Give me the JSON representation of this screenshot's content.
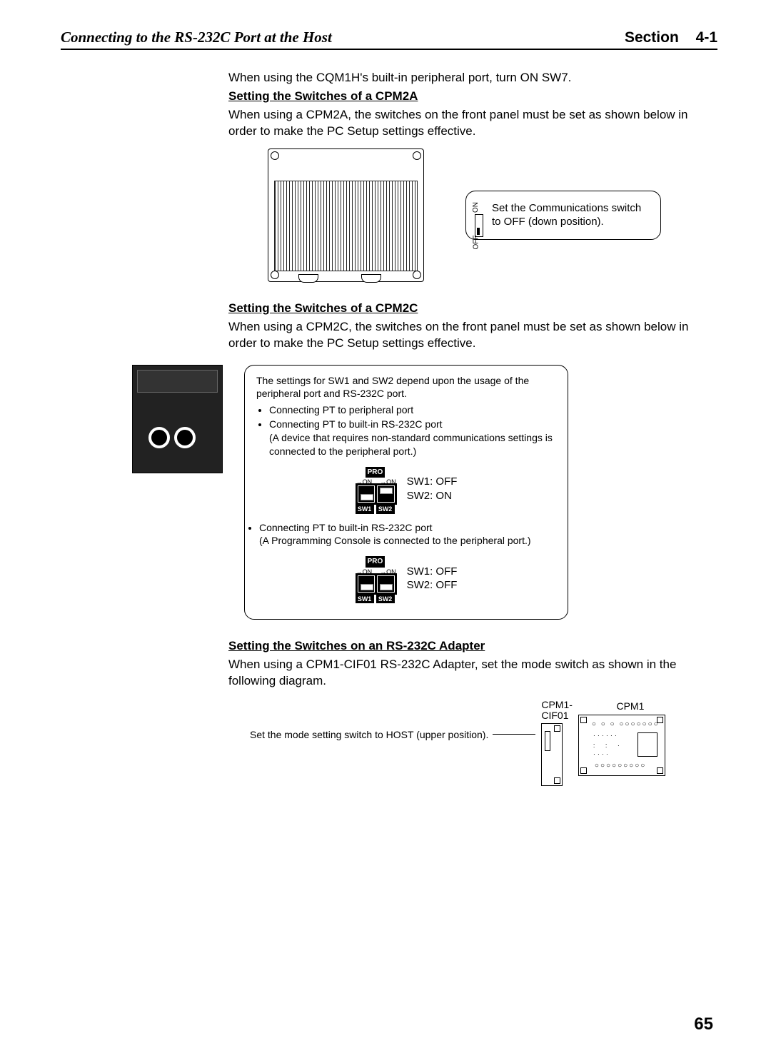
{
  "header": {
    "title": "Connecting to the RS-232C Port at the Host",
    "section_label": "Section",
    "section_num": "4-1"
  },
  "intro_line": "When using the CQM1H's built-in peripheral port, turn ON SW7.",
  "cpm2a": {
    "heading": "Setting the Switches of a CPM2A",
    "body": "When using a CPM2A, the switches on the front panel must be set as shown below in order to make the PC Setup settings effective.",
    "callout": "Set the Communications switch to OFF (down position).",
    "on_label": "ON",
    "off_label": "OFF"
  },
  "cpm2c": {
    "heading": "Setting the Switches of a CPM2C",
    "body": "When using a CPM2C, the switches on the front panel must be set as shown below in order to make the PC Setup settings effective.",
    "box_intro": "The settings for SW1 and SW2 depend upon the usage of the peripheral port and RS-232C port.",
    "bullet1": "Connecting PT to peripheral port",
    "bullet2": "Connecting PT to built-in RS-232C port",
    "bullet2_note": "(A device that requires non-standard communications settings is connected to the peripheral port.)",
    "state1_sw1": "SW1: OFF",
    "state1_sw2": "SW2: ON",
    "bullet3": "Connecting PT to built-in RS-232C port",
    "bullet3_note": "(A Programming Console is connected to the peripheral port.)",
    "state2_sw1": "SW1: OFF",
    "state2_sw2": "SW2: OFF",
    "pro": "PRO",
    "sw1": "SW1",
    "sw2": "SW2",
    "arrow_on": "→ON"
  },
  "adapter": {
    "heading": "Setting the Switches on an RS-232C Adapter",
    "body": "When using a CPM1-CIF01 RS-232C Adapter, set the mode switch as shown in the following diagram.",
    "caption": "Set the mode setting switch to HOST (upper position).",
    "cif01_label": "CPM1-\nCIF01",
    "cpm1_label": "CPM1"
  },
  "page_number": "65"
}
